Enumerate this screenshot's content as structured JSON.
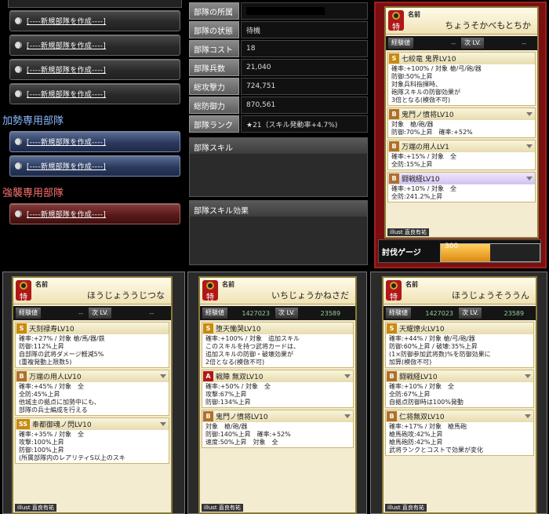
{
  "create_label": "[----新規部隊を作成----]",
  "section_kasei": "加勢専用部隊",
  "section_kyoshu": "強襲専用部隊",
  "info": {
    "rows": [
      {
        "label": "部隊の所属",
        "value": ""
      },
      {
        "label": "部隊の状態",
        "value": "待機"
      },
      {
        "label": "部隊コスト",
        "value": "18"
      },
      {
        "label": "部隊兵数",
        "value": "21,040"
      },
      {
        "label": "総攻撃力",
        "value": "724,751"
      },
      {
        "label": "総防御力",
        "value": "870,561"
      },
      {
        "label": "部隊ランク",
        "value": "★21（スキル発動率+4.7%)"
      }
    ],
    "skill_header": "部隊スキル",
    "skill_effect_header": "部隊スキル効果"
  },
  "gauge": {
    "label": "討伐ゲージ",
    "value": "300",
    "fill_fraction": 0.5
  },
  "cards": [
    {
      "name_label": "名前",
      "name": "ちょうそかべもとちか",
      "badge": "特",
      "exp_label": "経験値",
      "exp": "--",
      "next_label": "次 LV.",
      "next": "--",
      "skills": [
        {
          "rank": "S",
          "title": "七絞竜 鬼界LV10",
          "body": "確率:+100% / 対象 槍/弓/砲/器\n防御:50%上昇\n対象兵科指揮時、\n砲隊スキルの防御効果が\n3倍となる(模倣不可)",
          "color": "gold"
        },
        {
          "rank": "B",
          "title": "鬼門ノ憤将LV10",
          "body": "対象　槍/砲/器\n防御:70%上昇　確率:+52%",
          "color": "gold"
        },
        {
          "rank": "B",
          "title": "万端の用人LV1",
          "body": "確率:+15% / 対象　全\n全防:15%上昇",
          "color": "gold"
        },
        {
          "rank": "B",
          "title": "闘戦経LV10",
          "body": "確率:+10% / 対象　全\n全防:241.2%上昇",
          "color": "purple"
        }
      ],
      "illust": "illust 直良有祐"
    },
    {
      "name_label": "名前",
      "name": "ほうじょううじつな",
      "badge": "特",
      "exp_label": "経験値",
      "exp": "--",
      "next_label": "次 LV.",
      "next": "--",
      "skills": [
        {
          "rank": "S",
          "title": "天刻禄寿LV10",
          "body": "確率:+27% / 対象 槍/馬/器/鉄\n防御:112%上昇\n自部隊の武将ダメージ軽減5%\n(重複発動上限数5)",
          "color": "gold"
        },
        {
          "rank": "B",
          "title": "万端の用人LV10",
          "body": "確率:+45% / 対象　全\n全防:45%上昇\n他城主の拠点に加勢中にも、\n部隊の兵士編成を行える",
          "color": "gold"
        },
        {
          "rank": "SS",
          "title": "奉都御魂ノ閃LV10",
          "body": "確率:+35% / 対象　全\n攻撃:100%上昇\n防御:100%上昇\n(所属部隊内のレアリティS以上のスキ",
          "color": "gold"
        }
      ],
      "illust": "illust 直良有祐"
    },
    {
      "name_label": "名前",
      "name": "いちじょうかねさだ",
      "badge": "特",
      "exp_label": "経験値",
      "exp": "1427023",
      "next_label": "次 LV.",
      "next": "23589",
      "skills": [
        {
          "rank": "S",
          "title": "堕天慟哭LV10",
          "body": "確率:+100% / 対象　追加スキル\nこのスキルを持つ武将カードは、\n追加スキルの防御・破壊効果が\n2倍となる(模倣不可)",
          "color": "gold"
        },
        {
          "rank": "A",
          "title": "戦陣 無双LV10",
          "body": "確率:+50% / 対象　全\n攻撃:67%上昇\n防御:134%上昇",
          "color": "gold"
        },
        {
          "rank": "B",
          "title": "鬼門ノ憤将LV10",
          "body": "対象　槍/砲/器\n防御:140%上昇　確率:+52%\n速度:50%上昇　対象　全",
          "color": "gold"
        }
      ],
      "illust": "illust 直良有祐"
    },
    {
      "name_label": "名前",
      "name": "ほうじょうそううん",
      "badge": "特",
      "exp_label": "経験値",
      "exp": "1427023",
      "next_label": "次 LV.",
      "next": "23589",
      "skills": [
        {
          "rank": "S",
          "title": "天耀燎火LV10",
          "body": "確率:+44% / 対象 槍/弓/砲/器\n防御:60%上昇 / 破壊:35%上昇\n(1×防御参加武将数)%を防御効果に\n加算(模倣不可)",
          "color": "gold"
        },
        {
          "rank": "B",
          "title": "闘戦経LV10",
          "body": "確率:+10% / 対象　全\n全防:67%上昇\n自拠点防御時は100%発動",
          "color": "gold"
        },
        {
          "rank": "B",
          "title": "仁将無双LV10",
          "body": "確率:+17% / 対象　槍馬砲\n槍馬砲攻:42%上昇\n槍馬砲防:42%上昇\n武将ランクとコストで効果が変化",
          "color": "gold"
        }
      ],
      "illust": "illust 直良有祐"
    }
  ]
}
